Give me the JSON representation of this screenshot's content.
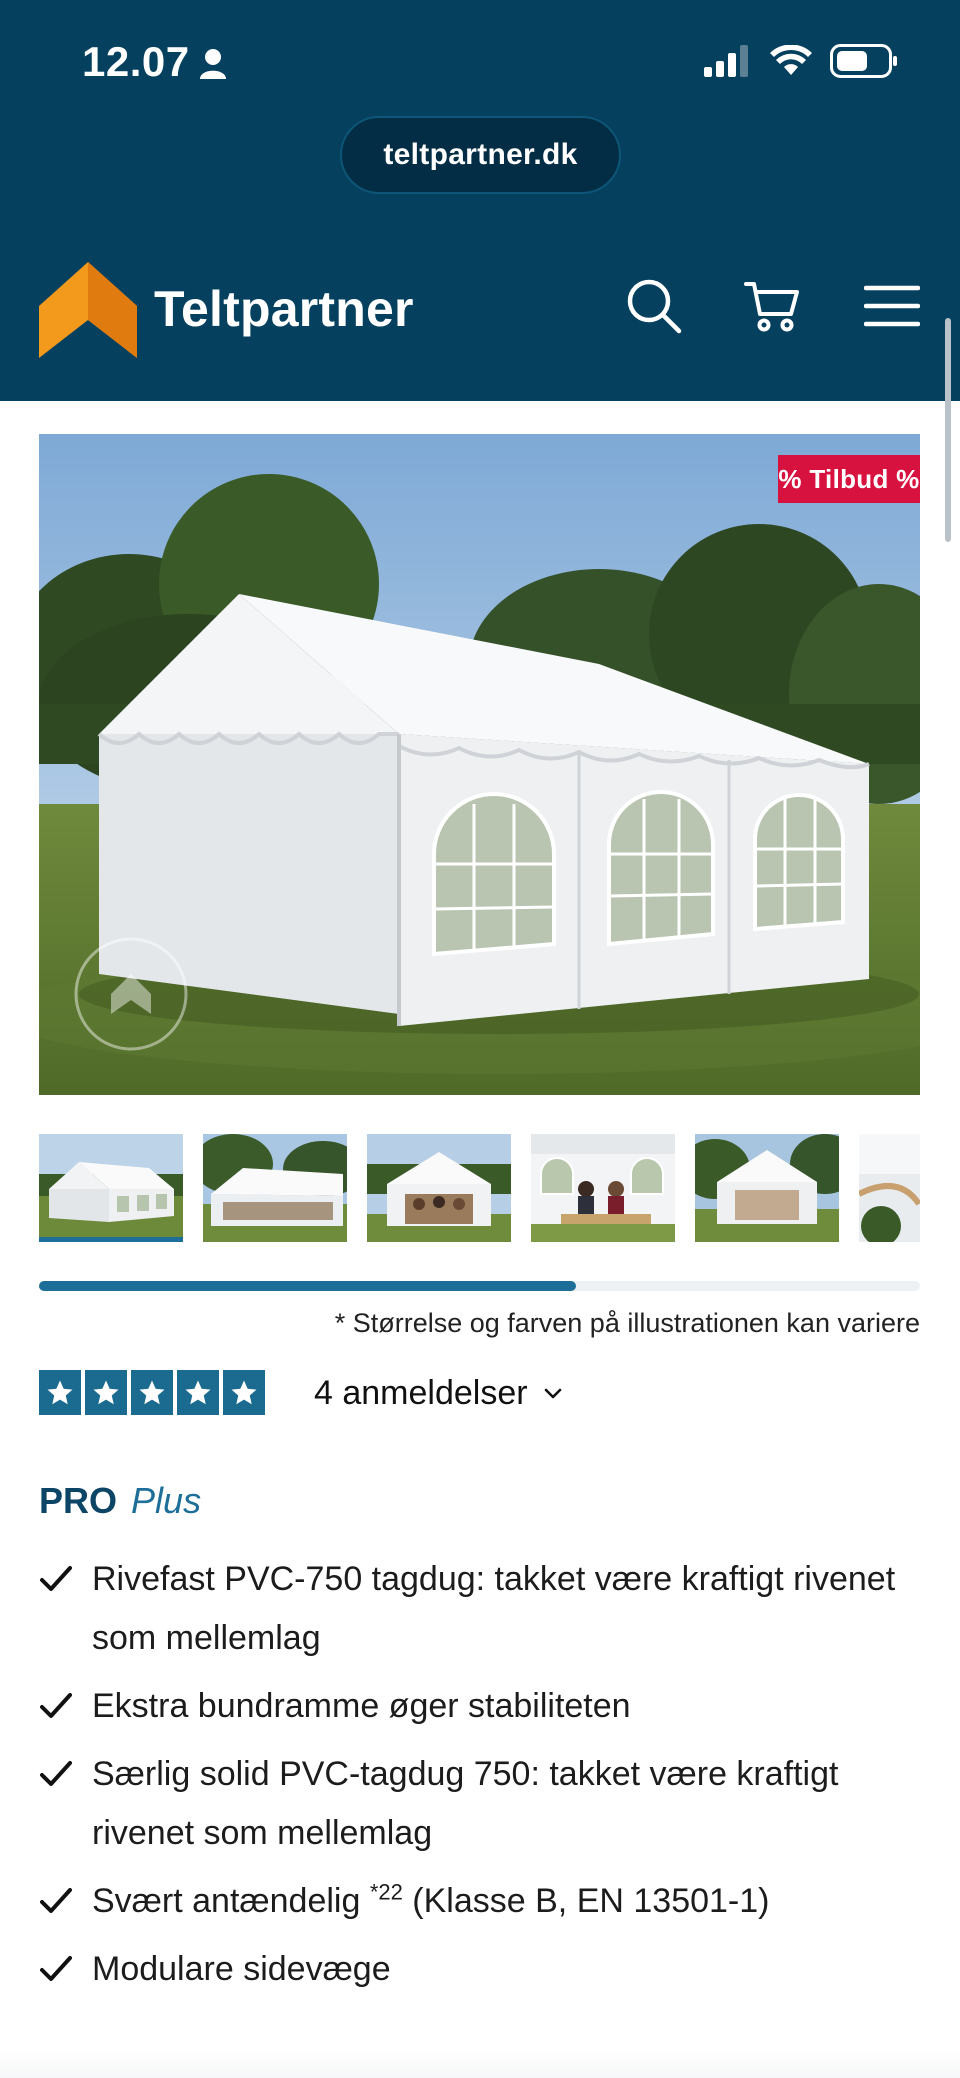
{
  "status_bar": {
    "time": "12.07"
  },
  "browser": {
    "url": "teltpartner.dk"
  },
  "header": {
    "brand": "Teltpartner"
  },
  "product": {
    "badge": "% Tilbud %",
    "gallery": {
      "thumbnail_count": 6,
      "active_index": 0,
      "scroll_progress": 0.61
    },
    "image_note": "* Størrelse og farven på illustrationen kan variere",
    "rating": {
      "stars": 5,
      "reviews_label": "4 anmeldelser"
    },
    "title": {
      "line": "PRO",
      "variant": "Plus"
    },
    "features": [
      {
        "text": "Rivefast PVC-750 tagdug: takket være kraftigt rivenet som mellemlag"
      },
      {
        "text": "Ekstra bundramme øger stabiliteten"
      },
      {
        "text": "Særlig solid PVC-tagdug 750: takket være kraftigt rivenet som mellemlag"
      },
      {
        "text": "Svært antændelig ",
        "sup": "*22",
        "after": " (Klasse B, EN 13501-1)"
      },
      {
        "text": "Modulare sidevæge"
      }
    ]
  },
  "colors": {
    "header_bg": "#05405f",
    "accent_blue": "#1d6f99",
    "badge_red": "#d8123e",
    "logo_orange": "#f39a1c"
  }
}
